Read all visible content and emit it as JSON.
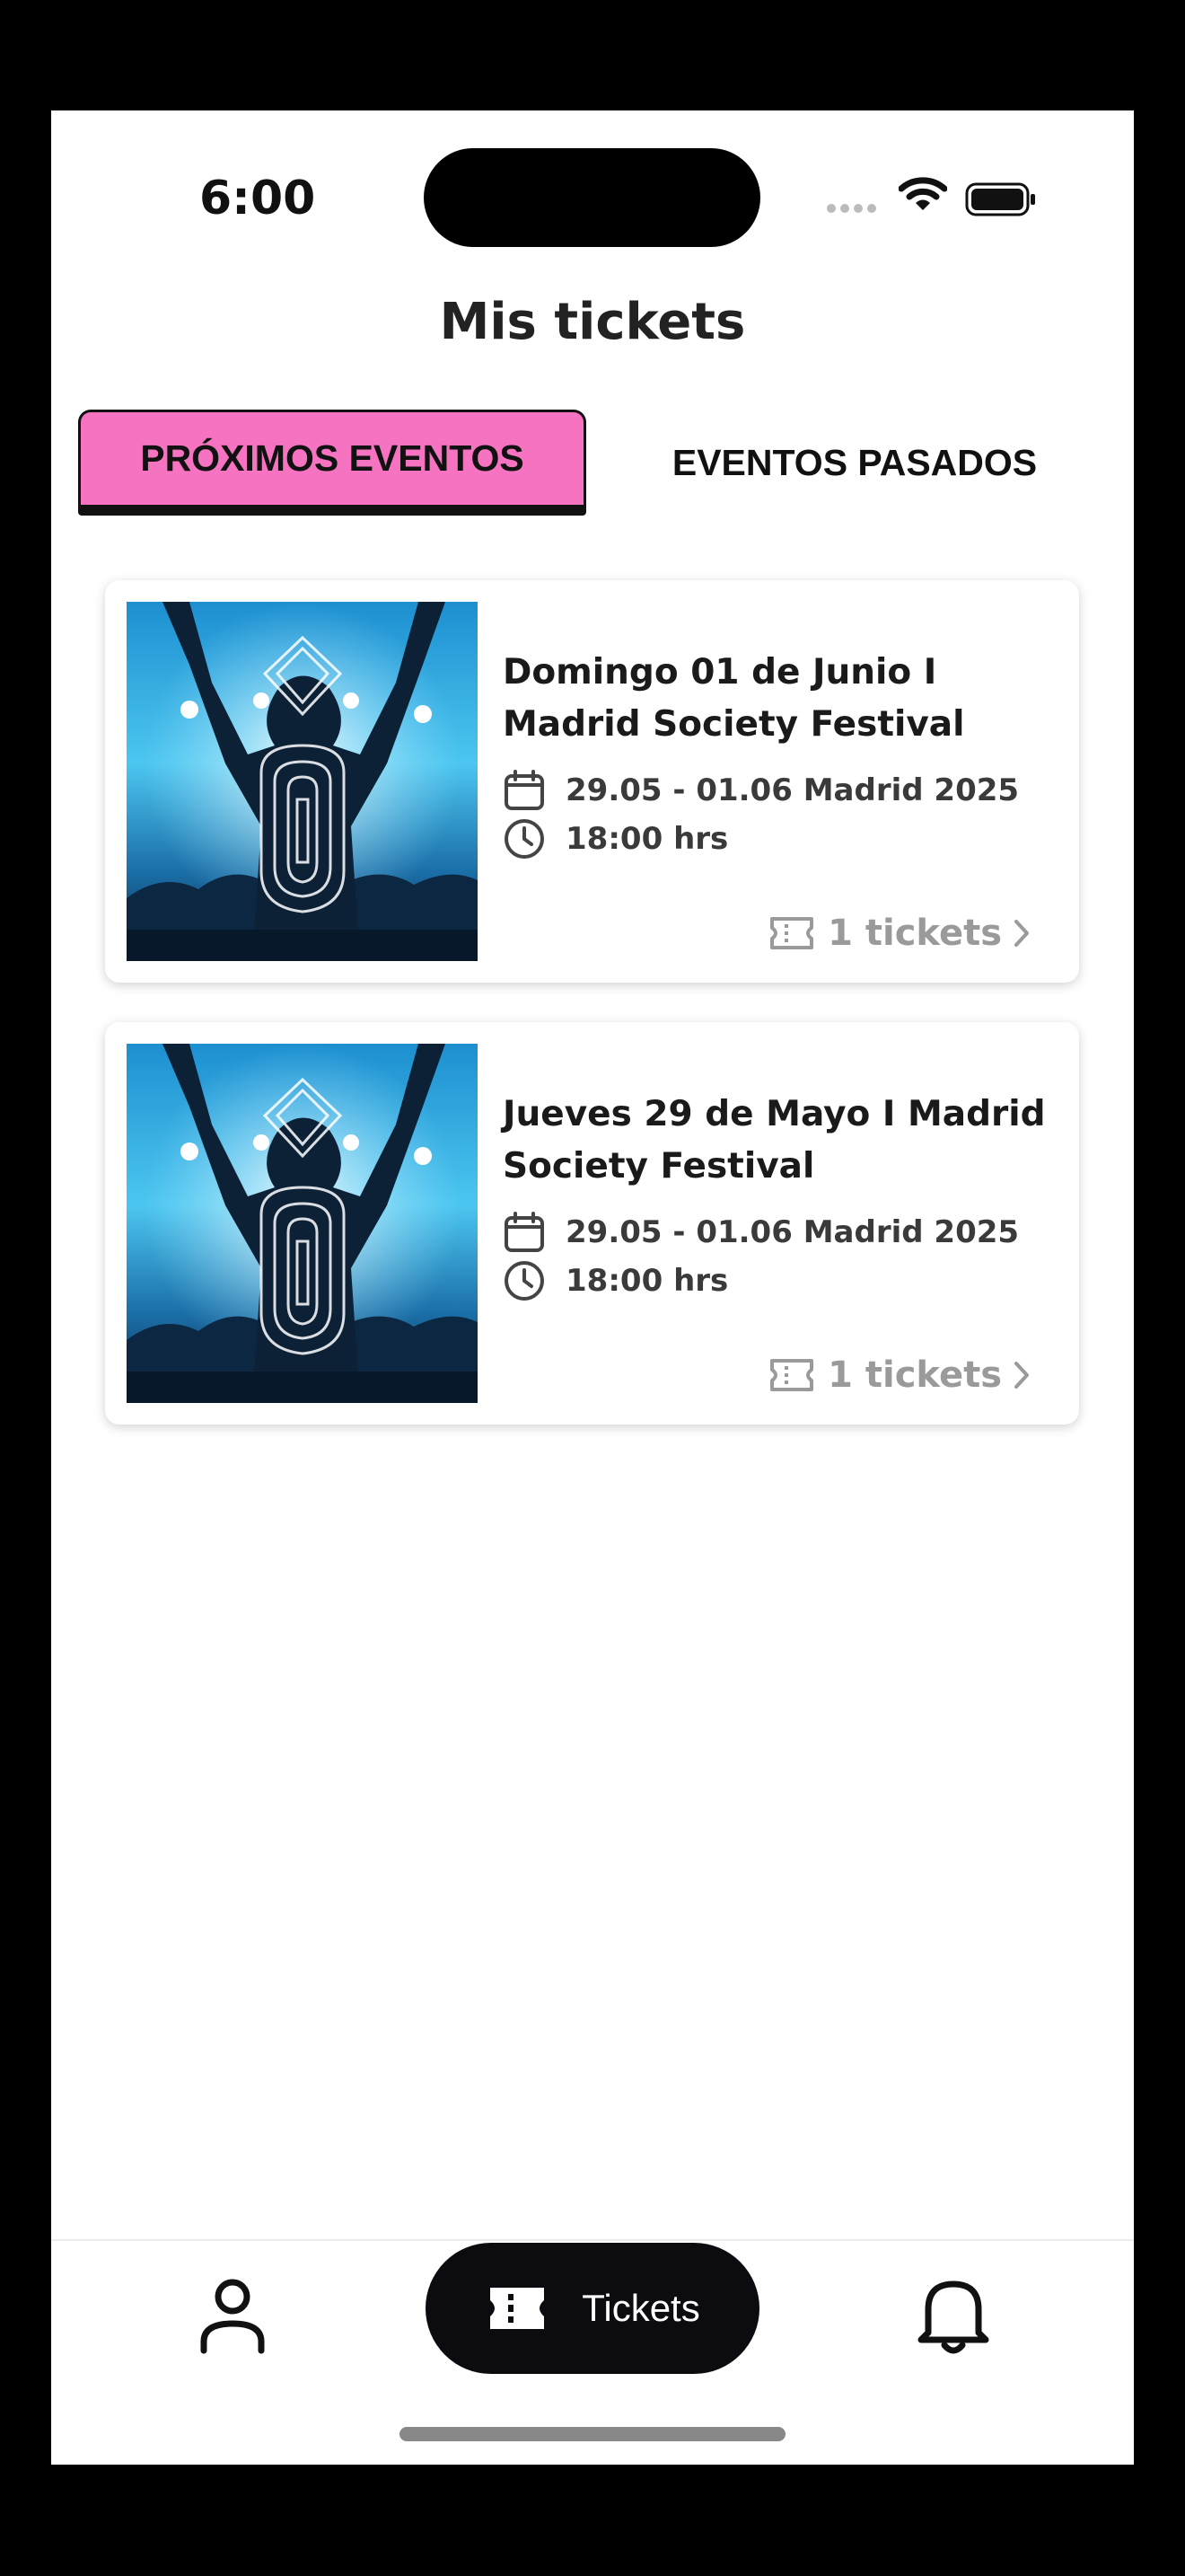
{
  "status_bar": {
    "time": "6:00"
  },
  "header": {
    "title": "Mis tickets"
  },
  "tabs": [
    {
      "label": "PRÓXIMOS EVENTOS",
      "active": true,
      "active_color": "#f573c0"
    },
    {
      "label": "EVENTOS PASADOS",
      "active": false
    }
  ],
  "events": [
    {
      "title": "Domingo 01 de Junio I Madrid Society Festival",
      "dates": "29.05 - 01.06 Madrid 2025",
      "time": "18:00 hrs",
      "tickets_label": "1 tickets",
      "image": "dj-crowd-image"
    },
    {
      "title": "Jueves 29 de Mayo I Madrid Society Festival",
      "dates": "29.05 - 01.06 Madrid 2025",
      "time": "18:00 hrs",
      "tickets_label": "1 tickets",
      "image": "dj-crowd-image"
    }
  ],
  "bottom_nav": {
    "profile_icon": "user-icon",
    "tickets_label": "Tickets",
    "tickets_icon": "ticket-icon",
    "notifications_icon": "bell-icon"
  },
  "colors": {
    "accent": "#f573c0",
    "nav_active_bg": "#0b0b10",
    "muted": "#9a9a9a"
  }
}
